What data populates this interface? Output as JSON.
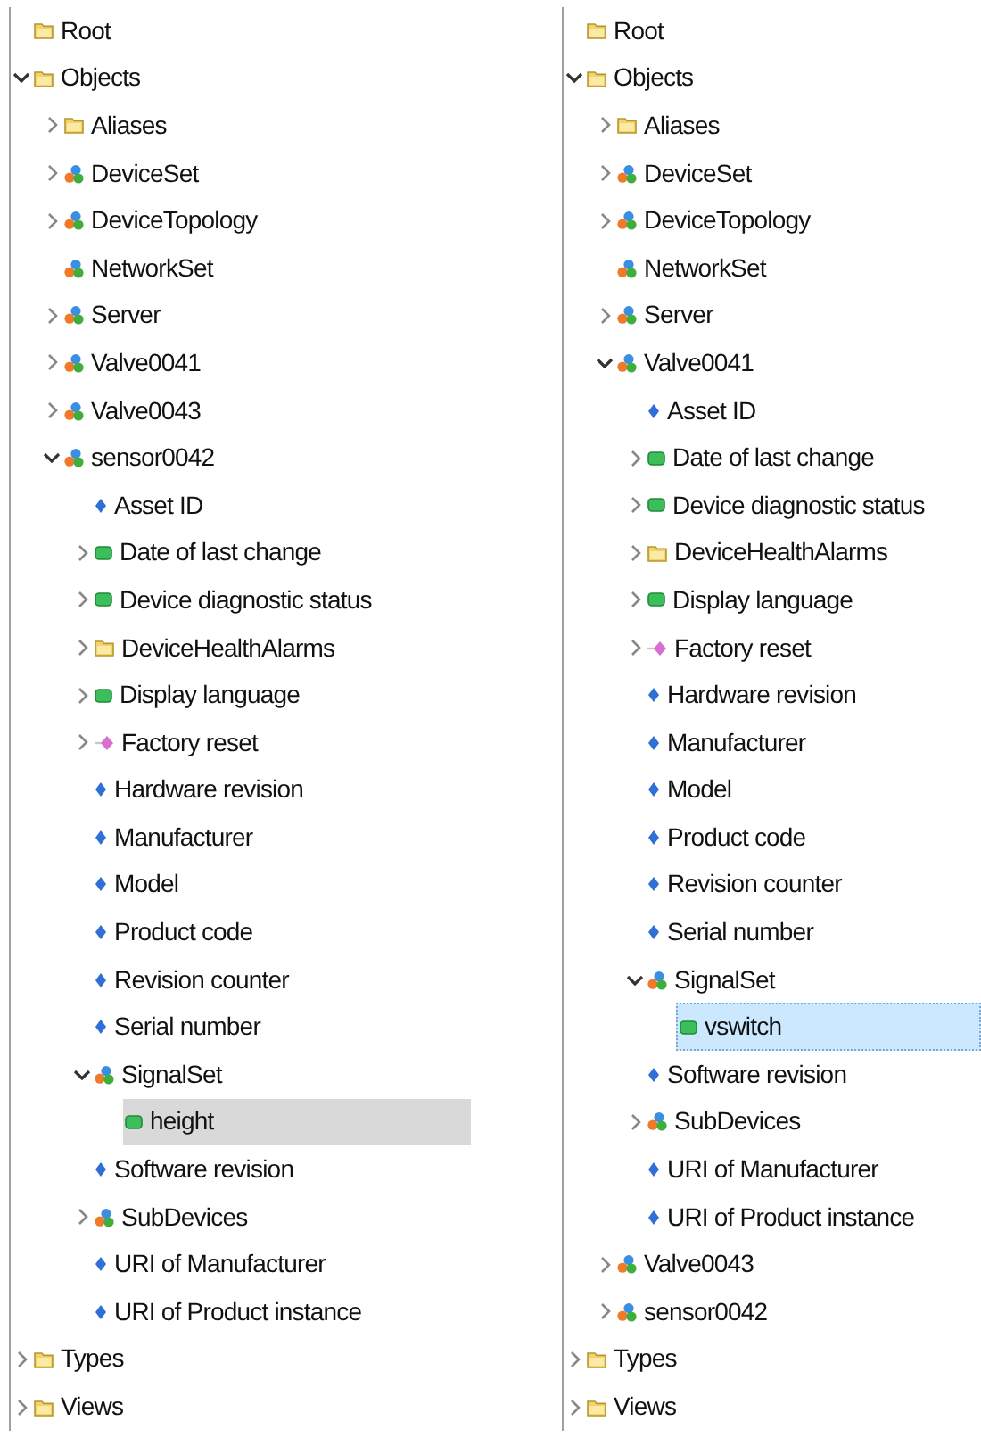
{
  "panels": [
    {
      "tree": [
        {
          "label": "Root",
          "kind": "folder",
          "selected": false
        },
        {
          "label": "Objects",
          "kind": "folder",
          "expanded": true,
          "selected": false,
          "children": [
            {
              "label": "Aliases",
              "kind": "folder",
              "expanded": false,
              "selected": false
            },
            {
              "label": "DeviceSet",
              "kind": "object",
              "expanded": false,
              "selected": false
            },
            {
              "label": "DeviceTopology",
              "kind": "object",
              "expanded": false,
              "selected": false
            },
            {
              "label": "NetworkSet",
              "kind": "object",
              "selected": false
            },
            {
              "label": "Server",
              "kind": "object",
              "expanded": false,
              "selected": false
            },
            {
              "label": "Valve0041",
              "kind": "object",
              "expanded": false,
              "selected": false
            },
            {
              "label": "Valve0043",
              "kind": "object",
              "expanded": false,
              "selected": false
            },
            {
              "label": "sensor0042",
              "kind": "object",
              "expanded": true,
              "selected": false,
              "children": [
                {
                  "label": "Asset ID",
                  "kind": "property",
                  "selected": false
                },
                {
                  "label": "Date of last change",
                  "kind": "variable",
                  "expanded": false,
                  "selected": false
                },
                {
                  "label": "Device diagnostic status",
                  "kind": "variable",
                  "expanded": false,
                  "selected": false
                },
                {
                  "label": "DeviceHealthAlarms",
                  "kind": "folder",
                  "expanded": false,
                  "selected": false
                },
                {
                  "label": "Display language",
                  "kind": "variable",
                  "expanded": false,
                  "selected": false
                },
                {
                  "label": "Factory reset",
                  "kind": "method",
                  "expanded": false,
                  "selected": false
                },
                {
                  "label": "Hardware revision",
                  "kind": "property",
                  "selected": false
                },
                {
                  "label": "Manufacturer",
                  "kind": "property",
                  "selected": false
                },
                {
                  "label": "Model",
                  "kind": "property",
                  "selected": false
                },
                {
                  "label": "Product code",
                  "kind": "property",
                  "selected": false
                },
                {
                  "label": "Revision counter",
                  "kind": "property",
                  "selected": false
                },
                {
                  "label": "Serial number",
                  "kind": "property",
                  "selected": false
                },
                {
                  "label": "SignalSet",
                  "kind": "object",
                  "expanded": true,
                  "selected": false,
                  "children": [
                    {
                      "label": "height",
                      "kind": "variable",
                      "selected": true,
                      "focus": false
                    }
                  ]
                },
                {
                  "label": "Software revision",
                  "kind": "property",
                  "selected": false
                },
                {
                  "label": "SubDevices",
                  "kind": "object",
                  "expanded": false,
                  "selected": false
                },
                {
                  "label": "URI of Manufacturer",
                  "kind": "property",
                  "selected": false
                },
                {
                  "label": "URI of Product instance",
                  "kind": "property",
                  "selected": false
                }
              ]
            }
          ]
        },
        {
          "label": "Types",
          "kind": "folder",
          "expanded": false,
          "selected": false
        },
        {
          "label": "Views",
          "kind": "folder",
          "expanded": false,
          "selected": false
        }
      ]
    },
    {
      "tree": [
        {
          "label": "Root",
          "kind": "folder",
          "selected": false
        },
        {
          "label": "Objects",
          "kind": "folder",
          "expanded": true,
          "selected": false,
          "children": [
            {
              "label": "Aliases",
              "kind": "folder",
              "expanded": false,
              "selected": false
            },
            {
              "label": "DeviceSet",
              "kind": "object",
              "expanded": false,
              "selected": false
            },
            {
              "label": "DeviceTopology",
              "kind": "object",
              "expanded": false,
              "selected": false
            },
            {
              "label": "NetworkSet",
              "kind": "object",
              "selected": false
            },
            {
              "label": "Server",
              "kind": "object",
              "expanded": false,
              "selected": false
            },
            {
              "label": "Valve0041",
              "kind": "object",
              "expanded": true,
              "selected": false,
              "children": [
                {
                  "label": "Asset ID",
                  "kind": "property",
                  "selected": false
                },
                {
                  "label": "Date of last change",
                  "kind": "variable",
                  "expanded": false,
                  "selected": false
                },
                {
                  "label": "Device diagnostic status",
                  "kind": "variable",
                  "expanded": false,
                  "selected": false
                },
                {
                  "label": "DeviceHealthAlarms",
                  "kind": "folder",
                  "expanded": false,
                  "selected": false
                },
                {
                  "label": "Display language",
                  "kind": "variable",
                  "expanded": false,
                  "selected": false
                },
                {
                  "label": "Factory reset",
                  "kind": "method",
                  "expanded": false,
                  "selected": false
                },
                {
                  "label": "Hardware revision",
                  "kind": "property",
                  "selected": false
                },
                {
                  "label": "Manufacturer",
                  "kind": "property",
                  "selected": false
                },
                {
                  "label": "Model",
                  "kind": "property",
                  "selected": false
                },
                {
                  "label": "Product code",
                  "kind": "property",
                  "selected": false
                },
                {
                  "label": "Revision counter",
                  "kind": "property",
                  "selected": false
                },
                {
                  "label": "Serial number",
                  "kind": "property",
                  "selected": false
                },
                {
                  "label": "SignalSet",
                  "kind": "object",
                  "expanded": true,
                  "selected": false,
                  "children": [
                    {
                      "label": "vswitch",
                      "kind": "variable",
                      "selected": true,
                      "focus": true
                    }
                  ]
                },
                {
                  "label": "Software revision",
                  "kind": "property",
                  "selected": false
                },
                {
                  "label": "SubDevices",
                  "kind": "object",
                  "expanded": false,
                  "selected": false
                },
                {
                  "label": "URI of Manufacturer",
                  "kind": "property",
                  "selected": false
                },
                {
                  "label": "URI of Product instance",
                  "kind": "property",
                  "selected": false
                }
              ]
            },
            {
              "label": "Valve0043",
              "kind": "object",
              "expanded": false,
              "selected": false
            },
            {
              "label": "sensor0042",
              "kind": "object",
              "expanded": false,
              "selected": false
            }
          ]
        },
        {
          "label": "Types",
          "kind": "folder",
          "expanded": false,
          "selected": false
        },
        {
          "label": "Views",
          "kind": "folder",
          "expanded": false,
          "selected": false
        }
      ]
    }
  ]
}
